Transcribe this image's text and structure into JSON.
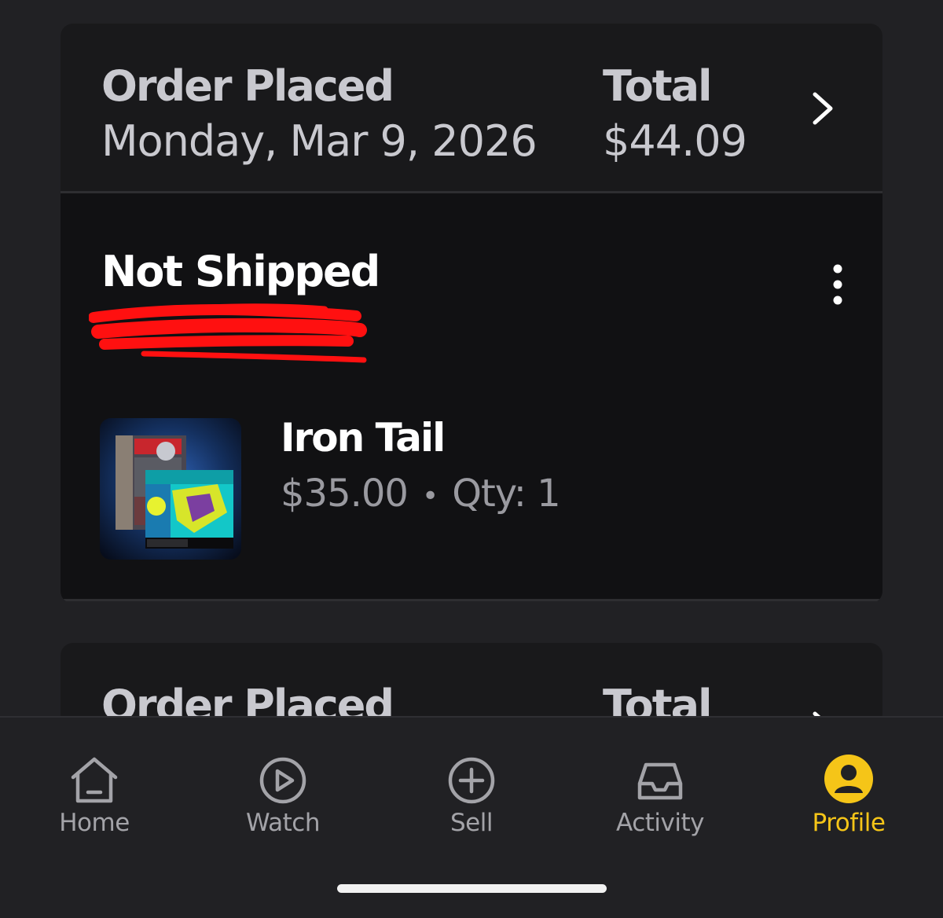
{
  "orders": [
    {
      "placed_label": "Order Placed",
      "placed_date": "Monday, Mar 9, 2026",
      "total_label": "Total",
      "total_value": "$44.09",
      "status": "Not Shipped",
      "item": {
        "title": "Iron Tail",
        "price": "$35.00",
        "separator": "•",
        "qty": "Qty: 1"
      }
    },
    {
      "placed_label": "Order Placed",
      "total_label": "Total"
    }
  ],
  "tabs": [
    {
      "label": "Home",
      "icon": "home-icon",
      "active": false
    },
    {
      "label": "Watch",
      "icon": "play-icon",
      "active": false
    },
    {
      "label": "Sell",
      "icon": "plus-circle-icon",
      "active": false
    },
    {
      "label": "Activity",
      "icon": "inbox-icon",
      "active": false
    },
    {
      "label": "Profile",
      "icon": "profile-icon",
      "active": true
    }
  ],
  "colors": {
    "background": "#212124",
    "card_header": "#19191b",
    "card_body": "#111113",
    "accent": "#f5c518",
    "redaction": "#ff1010"
  }
}
